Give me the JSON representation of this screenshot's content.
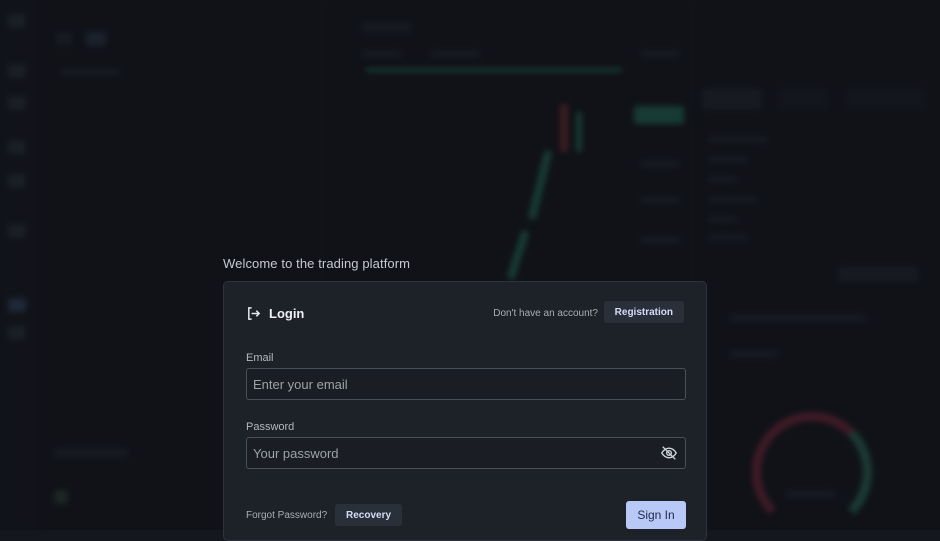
{
  "welcome_text": "Welcome to the trading platform",
  "login": {
    "title": "Login",
    "title_icon": "login-arrow-icon",
    "no_account_text": "Don't have an account?",
    "registration_label": "Registration",
    "email": {
      "label": "Email",
      "placeholder": "Enter your email",
      "value": ""
    },
    "password": {
      "label": "Password",
      "placeholder": "Your password",
      "value": "",
      "toggle_icon": "eye-off-icon"
    },
    "forgot_text": "Forgot Password?",
    "recovery_label": "Recovery",
    "signin_label": "Sign In"
  },
  "colors": {
    "background": "#14171d",
    "card": "#1d2128",
    "primary_button": "#b8c8f7",
    "accent_green": "#2f9c7b",
    "accent_red": "#b0324a"
  }
}
